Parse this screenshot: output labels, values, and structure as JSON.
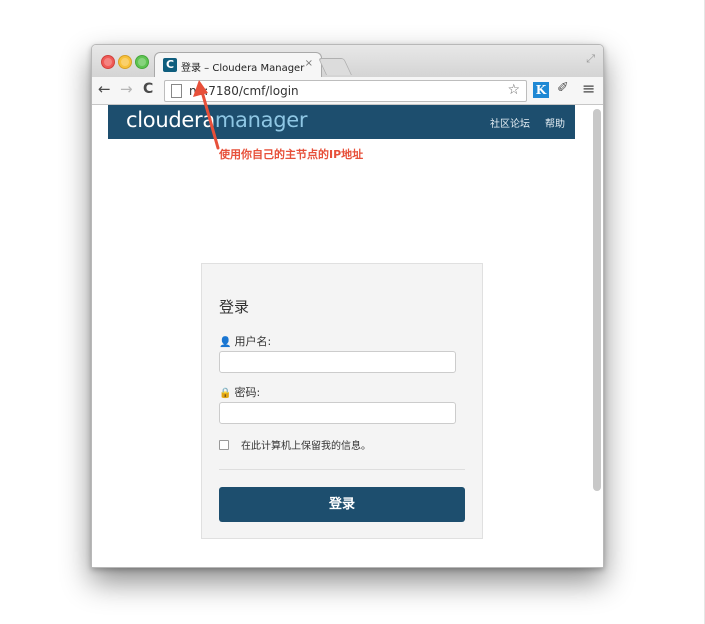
{
  "browser": {
    "tab_title": "登录 – Cloudera Manager",
    "tab_favicon_letter": "C",
    "tab_close": "×",
    "url": "n1:7180/cmf/login",
    "extension_k": "K",
    "icons": {
      "back": "arrow-left-icon",
      "forward": "arrow-right-icon",
      "reload": "reload-icon",
      "bookmark": "star-icon",
      "menu": "hamburger-menu-icon",
      "fullscreen": "fullscreen-icon"
    }
  },
  "header": {
    "logo_primary": "cloudera",
    "logo_secondary": "manager",
    "links": [
      "社区论坛",
      "帮助"
    ],
    "background": "#1d4e6e"
  },
  "annotation": {
    "text": "使用你自己的主节点的IP地址",
    "color": "#e7503a"
  },
  "login": {
    "title": "登录",
    "username_label": "用户名:",
    "username_value": "",
    "password_label": "密码:",
    "password_value": "",
    "remember_label": "在此计算机上保留我的信息。",
    "remember_checked": false,
    "submit_label": "登录"
  }
}
